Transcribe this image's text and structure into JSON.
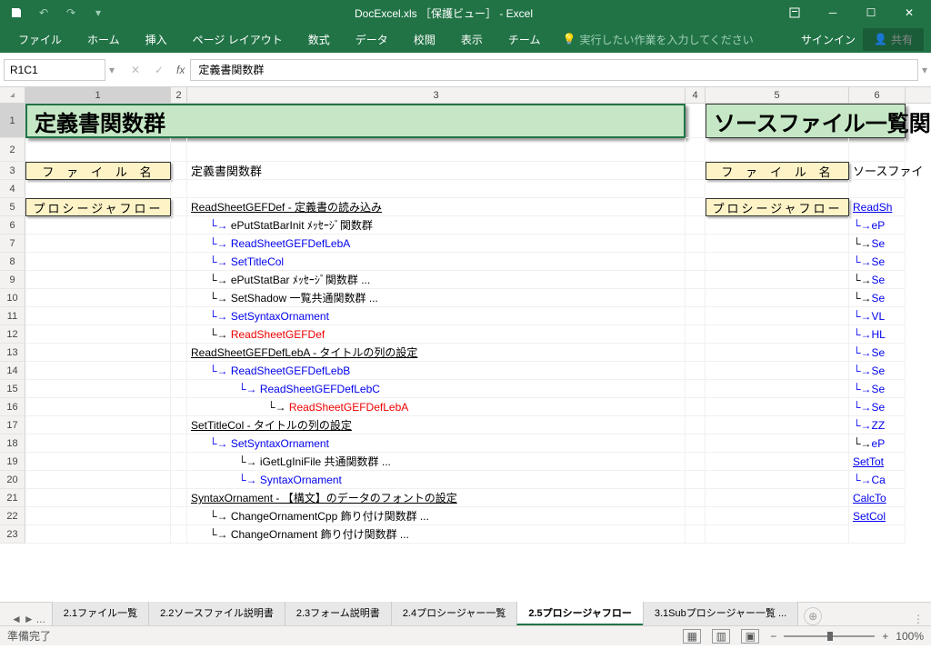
{
  "title": "DocExcel.xls ［保護ビュー］ - Excel",
  "tabs": {
    "file": "ファイル",
    "home": "ホーム",
    "insert": "挿入",
    "layout": "ページ レイアウト",
    "formula": "数式",
    "data": "データ",
    "review": "校閲",
    "view": "表示",
    "team": "チーム"
  },
  "tell": "実行したい作業を入力してください",
  "signin": "サインイン",
  "share": "共有",
  "namebox": "R1C1",
  "fvalue": "定義書関数群",
  "cols": [
    "1",
    "2",
    "3",
    "4",
    "5",
    "6"
  ],
  "rows": [
    "1",
    "2",
    "3",
    "4",
    "5",
    "6",
    "7",
    "8",
    "9",
    "10",
    "11",
    "12",
    "13",
    "14",
    "15",
    "16",
    "17",
    "18",
    "19",
    "20",
    "21",
    "22",
    "23"
  ],
  "h1a": "定義書関数群",
  "h1b": "ソースファイル一覧関数",
  "lbl_file": "フ ァ イ ル 名",
  "lbl_proc": "プロシージャフロー",
  "v3file": "定義書関数群",
  "v6file": "ソースファイ",
  "lines": [
    {
      "r": "5",
      "t": "ReadSheetGEFDef - 定義書の読み込み",
      "ul": 1,
      "i": 0
    },
    {
      "r": "6",
      "t": "ePutStatBarInit ﾒｯｾｰｼﾞ関数群",
      "i": 1,
      "a": "b"
    },
    {
      "r": "7",
      "t": "ReadSheetGEFDefLebA",
      "i": 1,
      "a": "b",
      "c": "blue"
    },
    {
      "r": "8",
      "t": "SetTitleCol",
      "i": 1,
      "a": "b",
      "c": "blue"
    },
    {
      "r": "9",
      "t": "ePutStatBar ﾒｯｾｰｼﾞ関数群 ...",
      "i": 1,
      "a": "k"
    },
    {
      "r": "10",
      "t": "SetShadow 一覧共通関数群 ...",
      "i": 1,
      "a": "k"
    },
    {
      "r": "11",
      "t": "SetSyntaxOrnament",
      "i": 1,
      "a": "b",
      "c": "blue"
    },
    {
      "r": "12",
      "t": "ReadSheetGEFDef <R>",
      "i": 1,
      "a": "k",
      "c": "red"
    },
    {
      "r": "13",
      "t": "ReadSheetGEFDefLebA - タイトルの列の設定",
      "ul": 1,
      "i": 0
    },
    {
      "r": "14",
      "t": "ReadSheetGEFDefLebB",
      "i": 1,
      "a": "b",
      "c": "blue"
    },
    {
      "r": "15",
      "t": "ReadSheetGEFDefLebC",
      "i": 2,
      "a": "b",
      "c": "blue"
    },
    {
      "r": "16",
      "t": "ReadSheetGEFDefLebA <R>",
      "i": 3,
      "a": "k",
      "c": "red"
    },
    {
      "r": "17",
      "t": "SetTitleCol - タイトルの列の設定",
      "ul": 1,
      "i": 0
    },
    {
      "r": "18",
      "t": "SetSyntaxOrnament",
      "i": 1,
      "a": "b",
      "c": "blue"
    },
    {
      "r": "19",
      "t": "iGetLgIniFile 共通関数群 ...",
      "i": 2,
      "a": "k"
    },
    {
      "r": "20",
      "t": "SyntaxOrnament",
      "i": 2,
      "a": "b",
      "c": "blue"
    },
    {
      "r": "21",
      "t": "SyntaxOrnament - 【構文】のデータのフォントの設定",
      "ul": 1,
      "i": 0
    },
    {
      "r": "22",
      "t": "ChangeOrnamentCpp 飾り付け関数群 ...",
      "i": 1,
      "a": "k"
    },
    {
      "r": "23",
      "t": "ChangeOrnament 飾り付け関数群 ...",
      "i": 1,
      "a": "k"
    }
  ],
  "rlines": {
    "5": {
      "t": "ReadSh",
      "ul": 1
    },
    "6": {
      "t": "eP",
      "a": "b"
    },
    "7": {
      "t": "Se",
      "a": "k"
    },
    "8": {
      "t": "Se",
      "a": "b"
    },
    "9": {
      "t": "Se",
      "a": "k"
    },
    "10": {
      "t": "Se",
      "a": "k"
    },
    "11": {
      "t": "VL",
      "a": "b"
    },
    "12": {
      "t": "HL",
      "a": "b"
    },
    "13": {
      "t": "Se",
      "a": "b"
    },
    "14": {
      "t": "Se",
      "a": "b"
    },
    "15": {
      "t": "Se",
      "a": "b"
    },
    "16": {
      "t": "Se",
      "a": "b"
    },
    "17": {
      "t": "ZZ",
      "a": "b"
    },
    "18": {
      "t": "eP",
      "a": "k"
    },
    "19": {
      "t": "SetTot",
      "ul": 1
    },
    "20": {
      "t": "Ca",
      "a": "b"
    },
    "21": {
      "t": "CalcTo",
      "ul": 1
    },
    "22": {
      "t": "SetCol",
      "ul": 1
    }
  },
  "sheets": [
    "2.1ファイル一覧",
    "2.2ソースファイル説明書",
    "2.3フォーム説明書",
    "2.4プロシージャー一覧",
    "2.5プロシージャフロー",
    "3.1Subプロシージャー一覧 ..."
  ],
  "activesheet": 4,
  "status": "準備完了",
  "zoom": "100%"
}
